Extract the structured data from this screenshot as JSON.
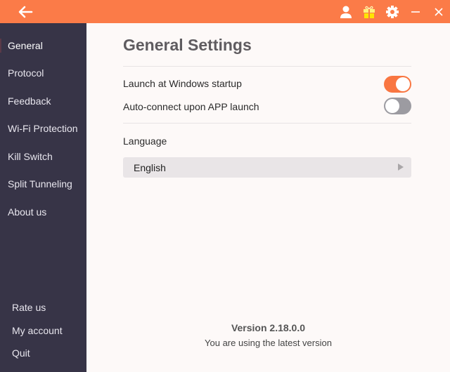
{
  "titlebar": {
    "back_icon": "arrow-left-icon",
    "icons": [
      "user-icon",
      "gift-icon",
      "gear-icon",
      "minimize-icon",
      "close-icon"
    ],
    "accent_color": "#fb7b48"
  },
  "sidebar": {
    "items": [
      {
        "label": "General",
        "active": true
      },
      {
        "label": "Protocol"
      },
      {
        "label": "Feedback"
      },
      {
        "label": "Wi-Fi Protection"
      },
      {
        "label": "Kill Switch"
      },
      {
        "label": "Split Tunneling"
      },
      {
        "label": "About us"
      }
    ],
    "bottom_items": [
      {
        "label": "Rate us"
      },
      {
        "label": "My account"
      },
      {
        "label": "Quit"
      }
    ]
  },
  "main": {
    "title": "General Settings",
    "settings": [
      {
        "label": "Launch at Windows startup",
        "enabled": true
      },
      {
        "label": "Auto-connect upon APP launch",
        "enabled": false
      }
    ],
    "language": {
      "label": "Language",
      "selected": "English"
    },
    "version": {
      "number": "Version 2.18.0.0",
      "status": "You are using the latest version"
    }
  }
}
